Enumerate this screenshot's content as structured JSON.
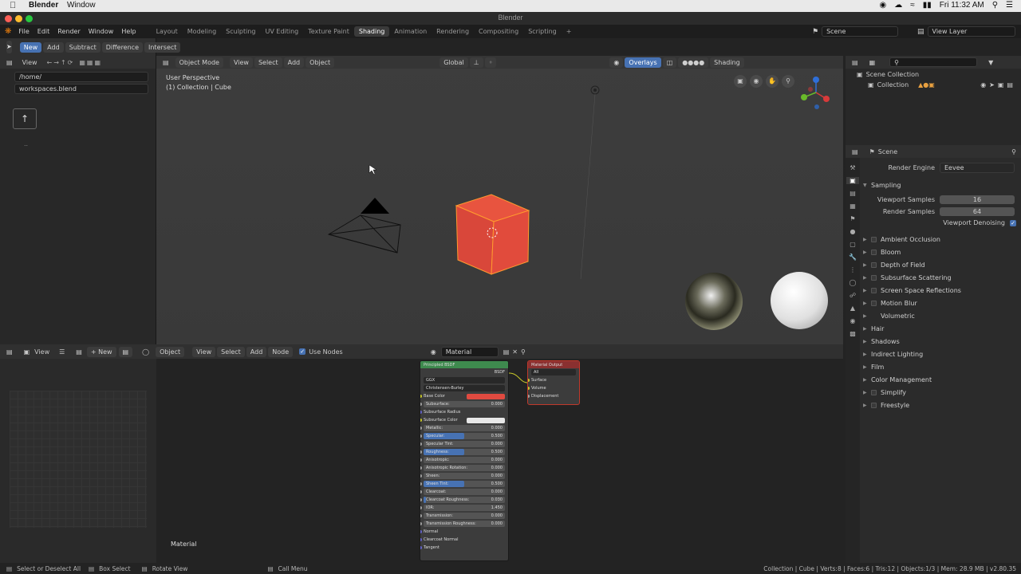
{
  "mac": {
    "app_name": "Blender",
    "menu_window": "Window",
    "clock": "Fri 11:32 AM"
  },
  "window_title": "Blender",
  "topbar": {
    "menus": [
      "File",
      "Edit",
      "Render",
      "Window",
      "Help"
    ],
    "workspaces": [
      "Layout",
      "Modeling",
      "Sculpting",
      "UV Editing",
      "Texture Paint",
      "Shading",
      "Animation",
      "Rendering",
      "Compositing",
      "Scripting"
    ],
    "active_workspace": "Shading",
    "scene": "Scene",
    "view_layer": "View Layer"
  },
  "filebrowser": {
    "header_buttons": [
      "New",
      "Add",
      "Subtract",
      "Difference",
      "Intersect"
    ],
    "view_label": "View",
    "path": "/home/",
    "file": "workspaces.blend",
    "dots": ".."
  },
  "viewport": {
    "mode": "Object Mode",
    "menus": [
      "View",
      "Select",
      "Add",
      "Object"
    ],
    "orientation": "Global",
    "overlays": "Overlays",
    "shading": "Shading",
    "info_line1": "User Perspective",
    "info_line2": "(1) Collection | Cube"
  },
  "outliner": {
    "root": "Scene Collection",
    "collection": "Collection"
  },
  "properties": {
    "scene_label": "Scene",
    "render_engine_label": "Render Engine",
    "render_engine": "Eevee",
    "sampling": "Sampling",
    "viewport_samples_label": "Viewport Samples",
    "viewport_samples": "16",
    "render_samples_label": "Render Samples",
    "render_samples": "64",
    "viewport_denoising": "Viewport Denoising",
    "panels_with_checkbox": [
      "Ambient Occlusion",
      "Bloom",
      "Depth of Field",
      "Subsurface Scattering",
      "Screen Space Reflections",
      "Motion Blur"
    ],
    "panels": [
      "Volumetric",
      "Hair",
      "Shadows",
      "Indirect Lighting",
      "Film",
      "Color Management",
      "Simplify",
      "Freestyle"
    ]
  },
  "bottom": {
    "view": "View",
    "new": "New",
    "object": "Object",
    "menus": [
      "View",
      "Select",
      "Add",
      "Node"
    ],
    "use_nodes": "Use Nodes",
    "material": "Material",
    "material_label": "Material"
  },
  "bsdf": {
    "title": "Principled BSDF",
    "output": "BSDF",
    "distribution": "GGX",
    "subsurface_method": "Christensen-Burley",
    "base_color_label": "Base Color",
    "base_color": "#e04a40",
    "subsurface_color_label": "Subsurface Color",
    "subsurface_radius_label": "Subsurface Radius",
    "params": [
      {
        "label": "Subsurface:",
        "value": "0.000",
        "fill": 0
      },
      {
        "label": "Metallic:",
        "value": "0.000",
        "fill": 0
      },
      {
        "label": "Specular:",
        "value": "0.500",
        "fill": 0.5
      },
      {
        "label": "Specular Tint:",
        "value": "0.000",
        "fill": 0
      },
      {
        "label": "Roughness:",
        "value": "0.500",
        "fill": 0.5
      },
      {
        "label": "Anisotropic:",
        "value": "0.000",
        "fill": 0
      },
      {
        "label": "Anisotropic Rotation:",
        "value": "0.000",
        "fill": 0
      },
      {
        "label": "Sheen:",
        "value": "0.000",
        "fill": 0
      },
      {
        "label": "Sheen Tint:",
        "value": "0.500",
        "fill": 0.5
      },
      {
        "label": "Clearcoat:",
        "value": "0.000",
        "fill": 0
      },
      {
        "label": "Clearcoat Roughness:",
        "value": "0.030",
        "fill": 0.03
      },
      {
        "label": "IOR:",
        "value": "1.450",
        "fill": 0
      },
      {
        "label": "Transmission:",
        "value": "0.000",
        "fill": 0
      },
      {
        "label": "Transmission Roughness:",
        "value": "0.000",
        "fill": 0
      }
    ],
    "vectors": [
      "Normal",
      "Clearcoat Normal",
      "Tangent"
    ]
  },
  "output_node": {
    "title": "Material Output",
    "target": "All",
    "sockets": [
      "Surface",
      "Volume",
      "Displacement"
    ]
  },
  "statusbar": {
    "select": "Select or Deselect All",
    "box": "Box Select",
    "rotate": "Rotate View",
    "call_menu": "Call Menu",
    "stats": "Collection | Cube | Verts:8 | Faces:6 | Tris:12 | Objects:1/3 | Mem: 28.9 MB | v2.80.35"
  }
}
